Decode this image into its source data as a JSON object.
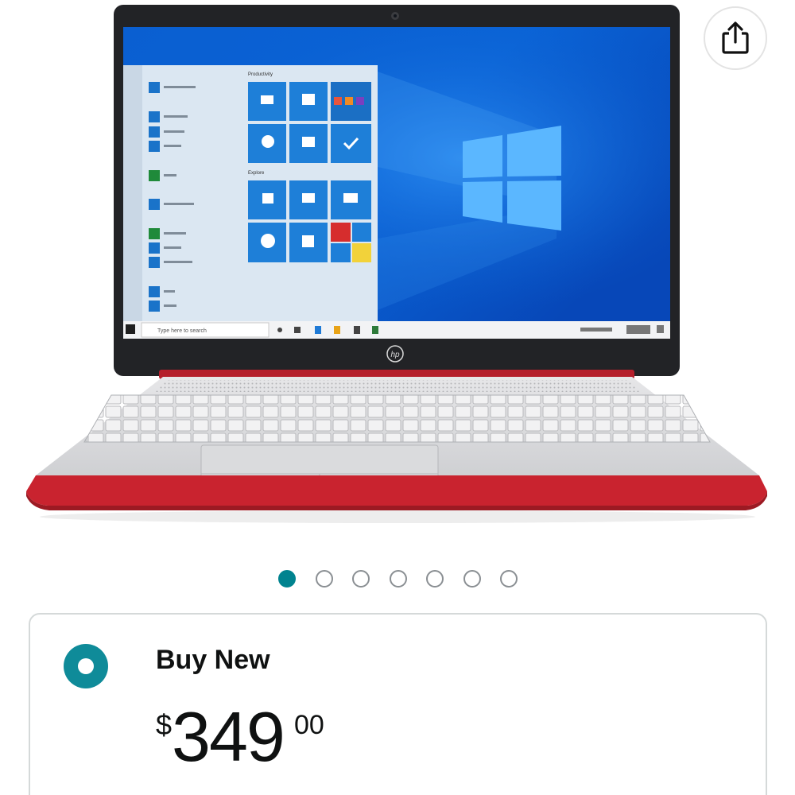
{
  "product": {
    "image_alt": "HP laptop in scarlet red with Windows 10 start menu on screen",
    "screen": {
      "taskbar_search": "Type here to search",
      "start_group_1": "Productivity",
      "start_group_2": "Explore",
      "brand_logo": "hp"
    }
  },
  "share": {
    "icon": "share-icon"
  },
  "carousel": {
    "count": 7,
    "active_index": 0
  },
  "buy": {
    "label": "Buy New",
    "price_symbol": "$",
    "price_whole": "349",
    "price_fraction": "00"
  },
  "colors": {
    "accent": "#00838f",
    "laptop_red": "#c9232f",
    "screen_blue": "#0a5fd1"
  }
}
